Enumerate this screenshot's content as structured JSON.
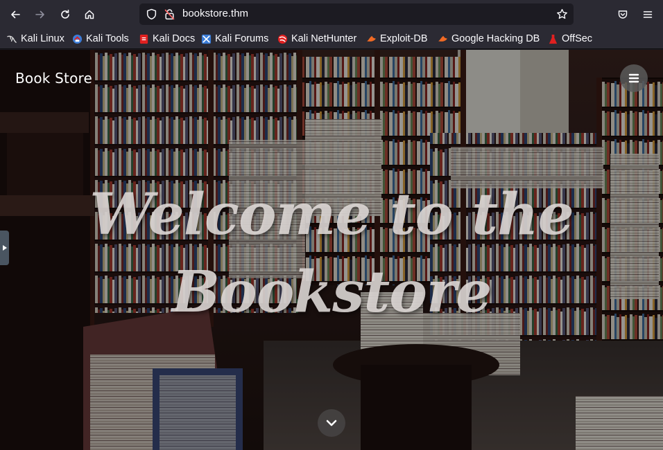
{
  "browser": {
    "url": "bookstore.thm",
    "bookmarks": [
      {
        "label": "Kali Linux",
        "icon": "kali-dragon-icon",
        "color": "#e6e6e6"
      },
      {
        "label": "Kali Tools",
        "icon": "kali-tools-icon",
        "color": "#3b7dd8"
      },
      {
        "label": "Kali Docs",
        "icon": "kali-docs-icon",
        "color": "#e02020"
      },
      {
        "label": "Kali Forums",
        "icon": "kali-forums-icon",
        "color": "#3b7dd8"
      },
      {
        "label": "Kali NetHunter",
        "icon": "kali-nethunter-icon",
        "color": "#e02020"
      },
      {
        "label": "Exploit-DB",
        "icon": "exploit-db-icon",
        "color": "#f06a24"
      },
      {
        "label": "Google Hacking DB",
        "icon": "ghdb-icon",
        "color": "#f06a24"
      },
      {
        "label": "OffSec",
        "icon": "offsec-icon",
        "color": "#e02020"
      }
    ]
  },
  "site": {
    "brand": "Book Store",
    "hero_line1": "Welcome to the",
    "hero_line2": "Bookstore"
  },
  "colors": {
    "toolbar_bg": "#2b2a33",
    "urlbar_bg": "#1c1b22",
    "text": "#fbfbfe"
  }
}
